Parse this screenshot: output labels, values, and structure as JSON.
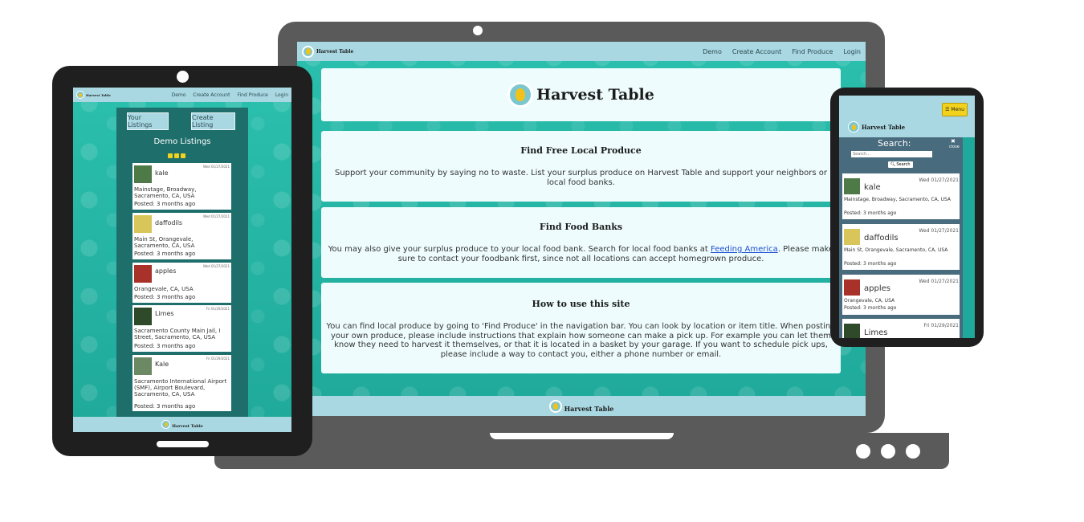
{
  "brand": {
    "name": "Harvest Table"
  },
  "nav": {
    "demo": "Demo",
    "create_account": "Create Account",
    "find_produce": "Find Produce",
    "login": "Login"
  },
  "laptop": {
    "hero_title": "Harvest Table",
    "sections": [
      {
        "title": "Find Free Local Produce",
        "body": "Support your community by saying no to waste. List your surplus produce on Harvest Table and support your neighbors or local food banks."
      },
      {
        "title": "Find Food Banks",
        "body_before": "You may also give your surplus produce to your local food bank. Search for local food banks at ",
        "link": "Feeding America",
        "body_after": ". Please make sure to contact your foodbank first, since not all locations can accept homegrown produce."
      },
      {
        "title": "How to use this site",
        "body": "You can find local produce by going to 'Find Produce' in the navigation bar. You can look by location or item title. When posting your own produce, please include instructions that explain how someone can make a pick up. For example you can let them know they need to harvest it themselves, or that it is located in a basket by your garage. If you want to schedule pick ups, please include a way to contact you, either a phone number or email."
      }
    ],
    "footer": "Harvest Table"
  },
  "tablet": {
    "your_listings": "Your Listings",
    "create_listing": "Create Listing",
    "heading": "Demo Listings",
    "listings": [
      {
        "title": "kale",
        "date": "Wed 01/27/2021",
        "address": "Mainstage, Broadway, Sacramento, CA, USA",
        "posted": "Posted: 3 months ago",
        "color": "#4d7a46"
      },
      {
        "title": "daffodils",
        "date": "Wed 01/27/2021",
        "address": "Main St, Orangevale, Sacramento, CA, USA",
        "posted": "Posted: 3 months ago",
        "color": "#d9c65a"
      },
      {
        "title": "apples",
        "date": "Wed 01/27/2021",
        "address": "Orangevale, CA, USA",
        "posted": "Posted: 3 months ago",
        "color": "#a8322a"
      },
      {
        "title": "Limes",
        "date": "Fri 01/29/2021",
        "address": "Sacramento County Main Jail, I Street, Sacramento, CA, USA",
        "posted": "Posted: 3 months ago",
        "color": "#2f4a28"
      },
      {
        "title": "Kale",
        "date": "Fri 01/29/2021",
        "address": "Sacramento International Airport (SMF), Airport Boulevard, Sacramento, CA, USA",
        "posted": "Posted: 3 months ago",
        "color": "#6b8a63"
      }
    ],
    "footer": "Harvest Table"
  },
  "phone": {
    "menu": "☰ Menu",
    "search_label": "Search:",
    "search_placeholder": "Search...",
    "search_button": "Search",
    "close": "close",
    "listings": [
      {
        "title": "kale",
        "date": "Wed 01/27/2021",
        "address": "Mainstage, Broadway, Sacramento, CA, USA",
        "posted": "Posted: 3 months ago",
        "color": "#4d7a46"
      },
      {
        "title": "daffodils",
        "date": "Wed 01/27/2021",
        "address": "Main St, Orangevale, Sacramento, CA, USA",
        "posted": "Posted: 3 months ago",
        "color": "#d9c65a"
      },
      {
        "title": "apples",
        "date": "Wed 01/27/2021",
        "address": "Orangevale, CA, USA",
        "posted": "Posted: 3 months ago",
        "color": "#a8322a"
      },
      {
        "title": "Limes",
        "date": "Fri 01/29/2021",
        "address": "",
        "posted": "",
        "color": "#2f4a28"
      }
    ]
  },
  "colors": {
    "nav": "#a9d8e2",
    "teal": "#26b8a8",
    "card": "#eefcfd",
    "panel": "#1e6f6b",
    "menu": "#f2d21c"
  }
}
